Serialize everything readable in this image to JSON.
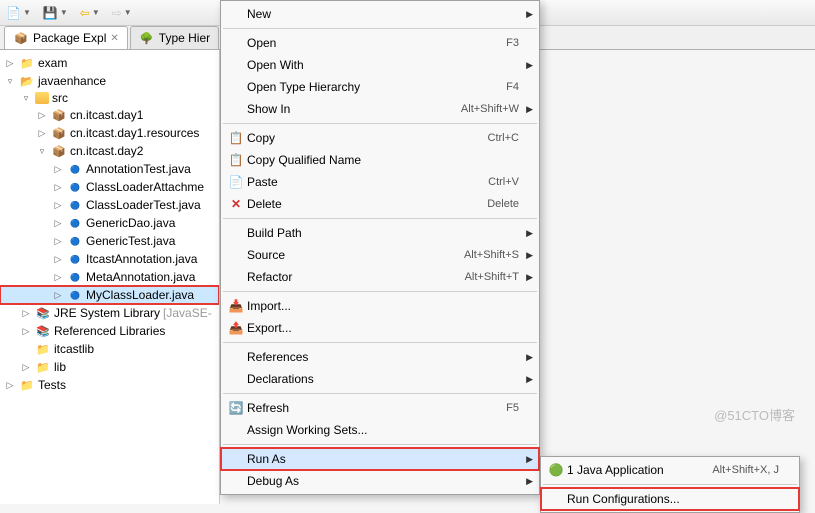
{
  "tabs": {
    "package_explorer": "Package Expl",
    "type_hierarchy": "Type Hier"
  },
  "tree": {
    "exam": "exam",
    "javaenhance": "javaenhance",
    "src": "src",
    "pkg1": "cn.itcast.day1",
    "pkg1res": "cn.itcast.day1.resources",
    "pkg2": "cn.itcast.day2",
    "files": {
      "f1": "AnnotationTest.java",
      "f2": "ClassLoaderAttachme",
      "f3": "ClassLoaderTest.java",
      "f4": "GenericDao.java",
      "f5": "GenericTest.java",
      "f6": "ItcastAnnotation.java",
      "f7": "MetaAnnotation.java",
      "f8": "MyClassLoader.java"
    },
    "jre": "JRE System Library",
    "jre_suffix": "[JavaSE-",
    "reflib": "Referenced Libraries",
    "itcastlib": "itcastlib",
    "lib": "lib",
    "tests": "Tests"
  },
  "menu": {
    "new": "New",
    "open": "Open",
    "open_with": "Open With",
    "open_type": "Open Type Hierarchy",
    "show_in": "Show In",
    "copy": "Copy",
    "copy_qn": "Copy Qualified Name",
    "paste": "Paste",
    "delete": "Delete",
    "build_path": "Build Path",
    "source": "Source",
    "refactor": "Refactor",
    "import": "Import...",
    "export": "Export...",
    "references": "References",
    "declarations": "Declarations",
    "refresh": "Refresh",
    "assign_ws": "Assign Working Sets...",
    "run_as": "Run As",
    "debug_as": "Debug As"
  },
  "shortcuts": {
    "open": "F3",
    "open_type": "F4",
    "show_in": "Alt+Shift+W",
    "copy": "Ctrl+C",
    "paste": "Ctrl+V",
    "delete": "Delete",
    "source": "Alt+Shift+S",
    "refactor": "Alt+Shift+T",
    "refresh": "F5"
  },
  "submenu": {
    "java_app": "1 Java Application",
    "java_app_sc": "Alt+Shift+X, J",
    "run_config": "Run Configurations..."
  },
  "watermark": "@51CTO博客"
}
